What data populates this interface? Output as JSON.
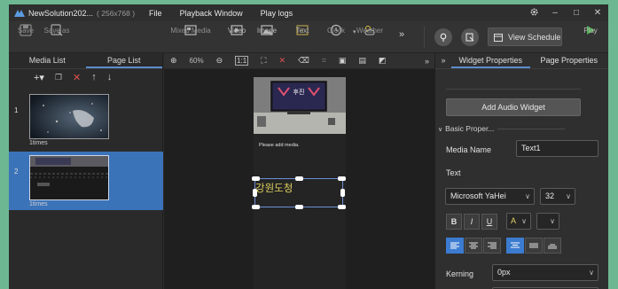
{
  "app": {
    "title": "NewSolution202...",
    "resolution": "( 256x768 )"
  },
  "menu": [
    "File",
    "Playback Window",
    "Play logs"
  ],
  "toolbar": {
    "save": "Save",
    "save_as": "Save as",
    "mixed_media": "Mixed Media",
    "video": "Video",
    "image": "Image",
    "text": "Text",
    "clock": "Clock",
    "weather": "Weather",
    "more": "»",
    "view_schedule": "View Schedule",
    "play": "Play"
  },
  "left_panel": {
    "tabs": [
      "Media List",
      "Page List"
    ],
    "active_tab": "Page List",
    "pages": [
      {
        "num": "1",
        "times": "1times"
      },
      {
        "num": "2",
        "times": "1times"
      }
    ]
  },
  "canvas_toolbar": {
    "zoom": "60%",
    "more": "»"
  },
  "canvas": {
    "banner_text": "후진",
    "please_add": "Please add media.",
    "text_widget": "강원도청"
  },
  "right_panel": {
    "tabs": [
      "Widget Properties",
      "Page Properties"
    ],
    "active_tab": "Widget Properties",
    "add_audio": "Add Audio Widget",
    "section": "Basic Proper...",
    "media_name_label": "Media Name",
    "media_name_value": "Text1",
    "text_label": "Text",
    "font_family": "Microsoft YaHei",
    "font_size": "32",
    "bold": "B",
    "italic": "I",
    "underline": "U",
    "color_letter": "A",
    "kerning_label": "Kerning",
    "kerning_value": "0px"
  },
  "colors": {
    "accent": "#3b73b9",
    "background": "#2b2b2b",
    "text_widget": "#e0d060",
    "play": "#4caf50"
  }
}
